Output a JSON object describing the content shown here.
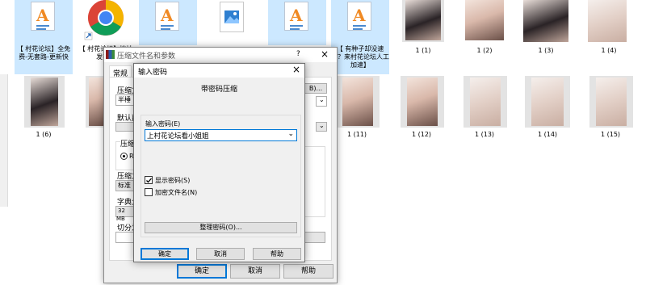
{
  "explorer": {
    "top_row": {
      "file1": "【 村花论坛】全免费-无套路-更新快",
      "file2": "【 村花论坛】地址发布...",
      "file6": "【 有种子却没速度？来村花论坛人工加速】",
      "img1": "1 (1)",
      "img2": "1 (2)",
      "img3": "1 (3)",
      "img4": "1 (4)"
    },
    "bottom_row": {
      "img6": "1 (6)",
      "img11": "1 (11)",
      "img12": "1 (12)",
      "img13": "1 (13)",
      "img14": "1 (14)",
      "img15": "1 (15)"
    }
  },
  "archive_dialog": {
    "title": "压缩文件名和参数",
    "help_button": "?",
    "close_button": "×",
    "tab_general": "常规",
    "label_archive_name": "压缩文",
    "archive_name_value": "半棰",
    "browse_button": "B)...",
    "label_default_profile": "默认酉",
    "label_format": "压缩",
    "format_option": "RA",
    "label_method": "压缩方",
    "method_value": "标准",
    "label_dict": "字典大",
    "dict_value": "32 MB",
    "label_split": "切分为",
    "side_letter": ")",
    "ok_button": "确定",
    "cancel_button": "取消",
    "help_bottom_button": "帮助"
  },
  "password_dialog": {
    "title": "输入密码",
    "close_button": "×",
    "heading": "带密码压缩",
    "password_label": "输入密码(E)",
    "password_value": "上村花论坛看小姐姐",
    "show_password_label": "显示密码(S)",
    "encrypt_names_label": "加密文件名(N)",
    "organize_button": "整理密码(O)...",
    "ok_button": "确定",
    "cancel_button": "取消",
    "help_button": "帮助",
    "show_password_checked": true,
    "encrypt_names_checked": false
  },
  "colors": {
    "accent_blue": "#0078d7",
    "selection": "#cce8ff",
    "doc_orange": "#f08a24"
  }
}
